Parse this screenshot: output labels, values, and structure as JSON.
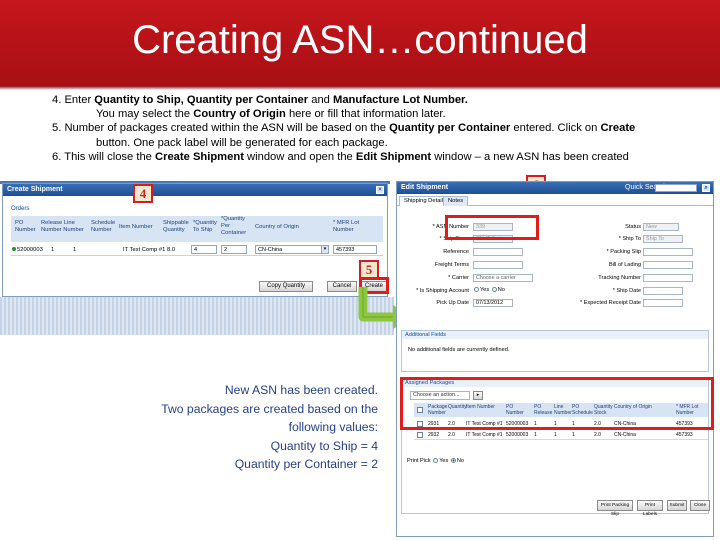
{
  "slide": {
    "title": "Creating ASN…continued",
    "steps": {
      "s4_a": "4. Enter ",
      "s4_b": "Quantity to Ship, Quantity per Container",
      "s4_c": " and ",
      "s4_d": "Manufacture Lot Number.",
      "s4_e": "You may select the ",
      "s4_f": "Country of Origin",
      "s4_g": " here or fill that information later.",
      "s5_a": "5. Number of packages created within the ASN will be based on the ",
      "s5_b": "Quantity per Container",
      "s5_c": " entered.  Click on ",
      "s5_d": "Create",
      "s5_e": "button. One pack label will be generated for each package.",
      "s6_a": "6. This will close the ",
      "s6_b": "Create Shipment",
      "s6_c": " window and open the ",
      "s6_d": "Edit Shipment",
      "s6_e": " window – a new ASN has been created"
    },
    "markers": {
      "m4": "4",
      "m5": "5",
      "m6": "6"
    },
    "callout": {
      "l1": "New ASN has been created.",
      "l2": "Two packages are created based on the",
      "l3": "following values:",
      "l4": "Quantity to Ship = 4",
      "l5": "Quantity per Container = 2"
    },
    "colors": {
      "banner": "#c4161c",
      "marker": "#d21f1f",
      "arrow": "#8dc63f",
      "callout_text": "#27408b"
    }
  },
  "create_shipment": {
    "title": "Create Shipment",
    "orders_tab": "Orders",
    "headers": {
      "po": "PO\nNumber",
      "release": "Release Line\nNumber Number",
      "schedule": "Schedule\nNumber",
      "item": "Item Number",
      "shippable": "Shippable\nQuantity",
      "qty_ship": "*Quantity\nTo Ship",
      "qty_container": "*Quantity\nPer\nContainer",
      "country": "Country of Origin",
      "lot": "* MFR Lot\nNumber"
    },
    "row": {
      "po": "52000003",
      "release": "1",
      "line": "1",
      "item": "IT Test Comp #1",
      "shippable": "8.0",
      "qty_ship": "4",
      "qty_container": "2",
      "country": "CN-China",
      "lot": "457393"
    },
    "buttons": {
      "copy": "Copy Quantity",
      "cancel": "Cancel",
      "create": "Create"
    }
  },
  "edit_shipment": {
    "title": "Edit Shipment",
    "search_label": "Quick Search",
    "tabs": [
      "Shipping Details",
      "Notes"
    ],
    "fields": {
      "asn_label": "* ASN Number",
      "asn_value": "339",
      "ship_from_label": "* Ship From",
      "ship_from_value": "CN-IT Test",
      "reference_label": "Reference",
      "freight_label": "Freight Terms",
      "carrier_label": "* Carrier",
      "carrier_value": "Choose a carrier",
      "split_label": "* Is Shipping Account",
      "yes": "Yes",
      "no": "No",
      "pickup_label": "Pick Up Date",
      "pickup_value": "07/13/2012",
      "status_label": "Status",
      "status_value": "New",
      "ship_to_label": "* Ship To",
      "ship_to_value": "Ship To",
      "packing_label": "* Packing Slip",
      "bill_lading_label": "Bill of Lading",
      "tracking_label": "Tracking Number",
      "ship_date_label": "* Ship Date",
      "expected_label": "* Expected Receipt Date"
    },
    "additional": {
      "title": "Additional Fields",
      "text": "No additional fields are currently defined."
    },
    "packages": {
      "title": "Assigned Packages",
      "action": "Choose an action...",
      "headers": [
        "Package\nNumber",
        "Quantity",
        "Item Number",
        "PO\nNumber",
        "PO\nRelease",
        "Line\nNumber",
        "PO\nSchedule",
        "Quantity\nStock",
        "Country of Origin",
        "* MFR Lot\nNumber"
      ],
      "rows": [
        [
          "2931",
          "2.0",
          "IT Test Comp #1",
          "52000003",
          "1",
          "1",
          "1",
          "2.0",
          "CN-China",
          "457393"
        ],
        [
          "2932",
          "2.0",
          "IT Test Comp #1",
          "52000003",
          "1",
          "1",
          "1",
          "2.0",
          "CN-China",
          "457393"
        ]
      ]
    },
    "print_label": "Print Pick",
    "buttons": {
      "print_packing": "Print Packing Slip",
      "print_labels": "Print Labels",
      "submit": "Submit",
      "close": "Close"
    }
  }
}
